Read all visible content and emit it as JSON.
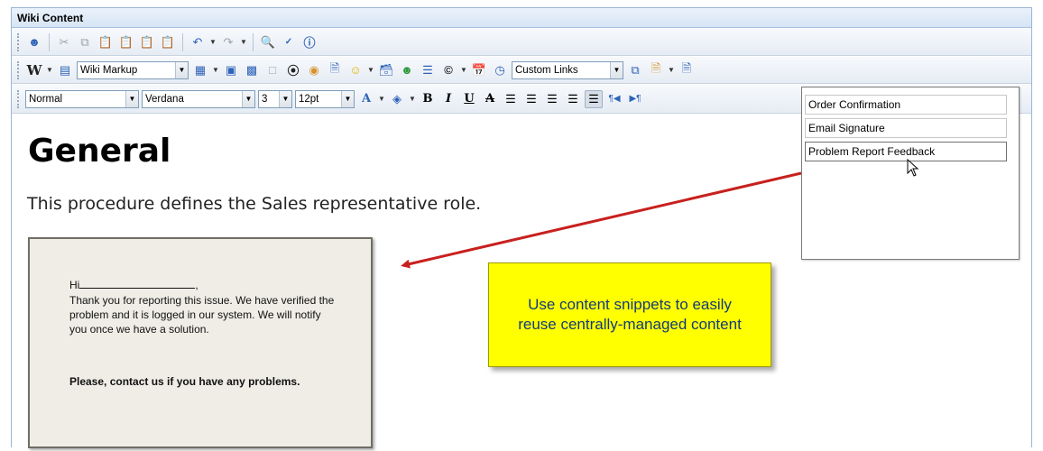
{
  "window": {
    "title": "Wiki Content"
  },
  "toolbar2": {
    "markup_select": "Wiki Markup",
    "links_select": "Custom Links"
  },
  "toolbar3": {
    "style_select": "Normal",
    "font_select": "Verdana",
    "size_select": "3",
    "pt_select": "12pt"
  },
  "content": {
    "heading": "General",
    "paragraph": "This procedure defines the Sales representative role."
  },
  "snippet": {
    "greeting": "Hi",
    "greeting_end": ",",
    "body": "Thank you for reporting this issue. We have verified the problem and it is logged in our system. We will notify you once we have a solution.",
    "bold": "Please, contact us if you have any problems."
  },
  "callout": {
    "text": "Use content snippets to easily reuse centrally-managed content"
  },
  "snippet_menu": {
    "items": [
      "Order Confirmation",
      "Email Signature",
      "Problem Report Feedback"
    ]
  },
  "colors": {
    "callout_bg": "#ffff00",
    "callout_text": "#143a7a",
    "arrow": "#c8201e",
    "title_bar": "#d6e4f4"
  }
}
